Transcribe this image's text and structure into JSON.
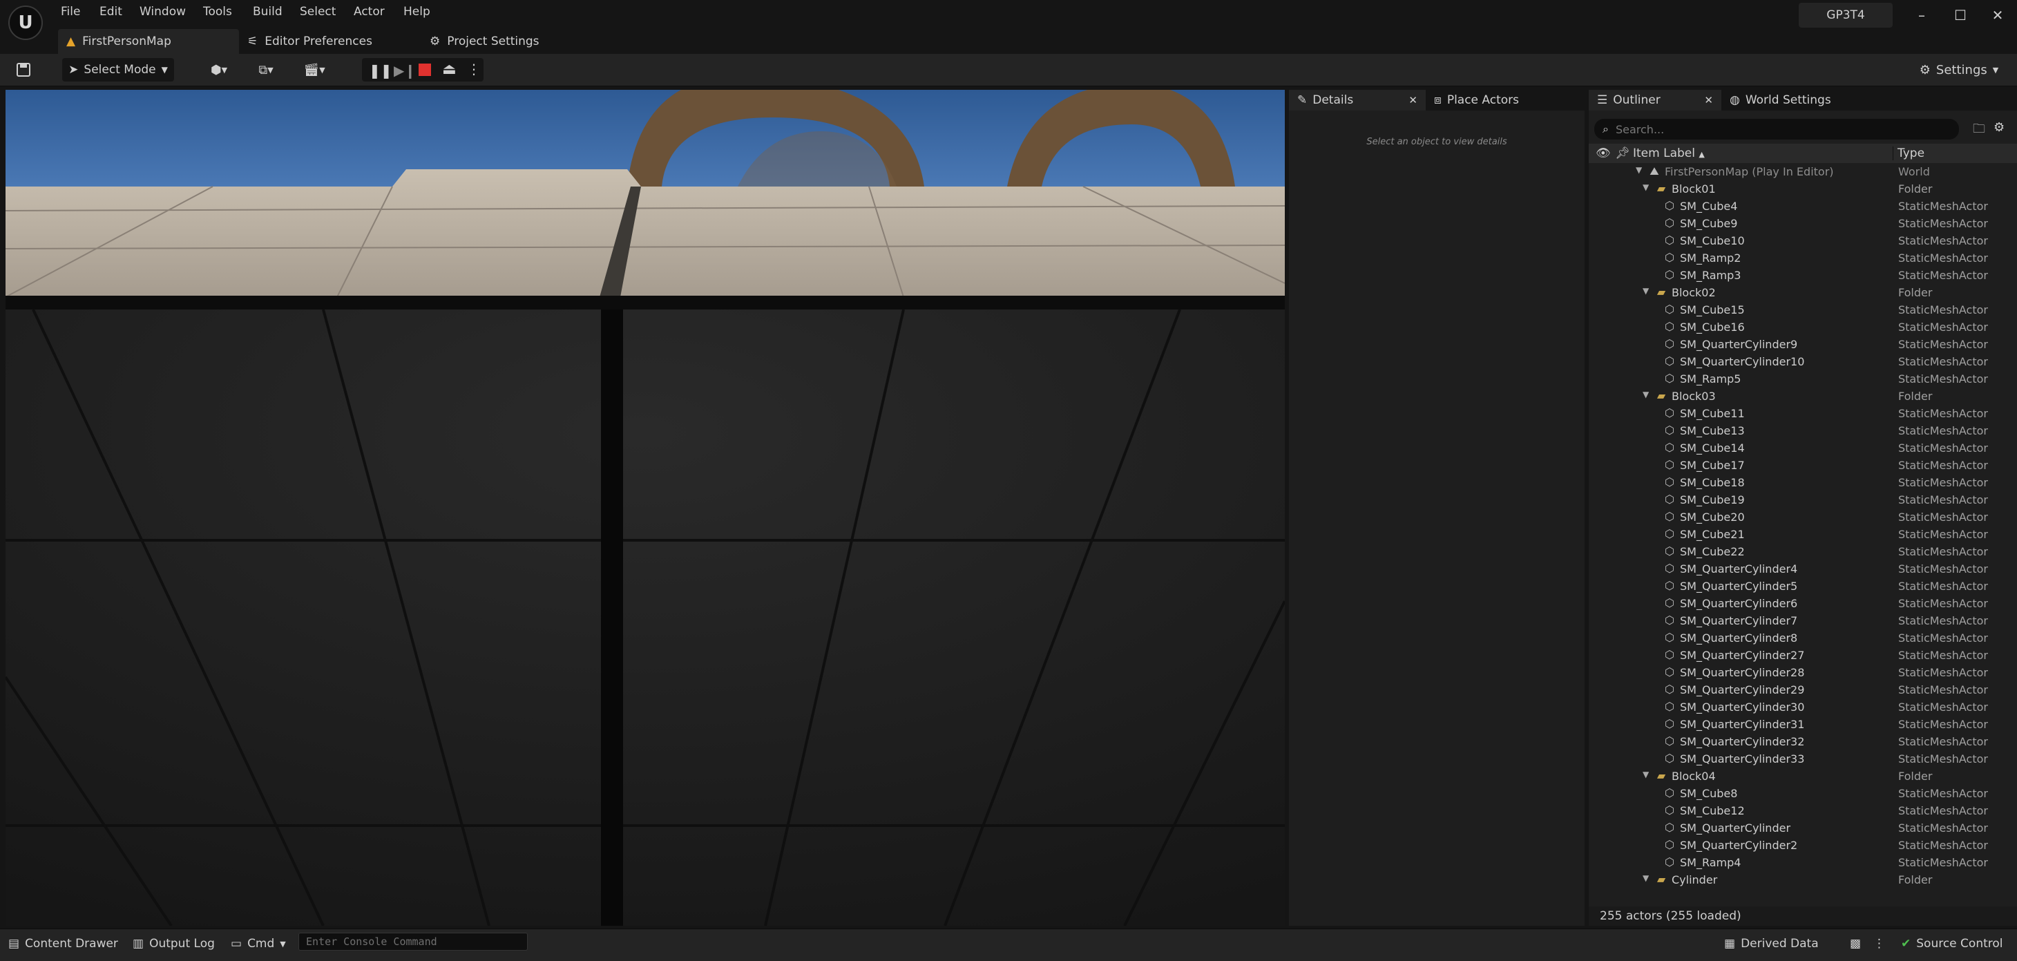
{
  "menu": [
    "File",
    "Edit",
    "Window",
    "Tools",
    "Build",
    "Select",
    "Actor",
    "Help"
  ],
  "project_name": "GP3T4",
  "tabs": {
    "map": "FirstPersonMap",
    "editor_prefs": "Editor Preferences",
    "project_settings": "Project Settings"
  },
  "toolbar": {
    "select_mode": "Select Mode",
    "settings": "Settings"
  },
  "details": {
    "tab_details": "Details",
    "tab_place": "Place Actors",
    "empty_message": "Select an object to view details"
  },
  "outliner": {
    "tab_outliner": "Outliner",
    "tab_world": "World Settings",
    "search_placeholder": "Search...",
    "col_label": "Item Label",
    "col_type": "Type",
    "footer": "255 actors (255 loaded)",
    "rows": [
      {
        "label": "FirstPersonMap (Play In Editor)",
        "type": "World",
        "kind": "world",
        "depth": 0
      },
      {
        "label": "Block01",
        "type": "Folder",
        "kind": "folder",
        "depth": 1
      },
      {
        "label": "SM_Cube4",
        "type": "StaticMeshActor",
        "kind": "actor",
        "depth": 2
      },
      {
        "label": "SM_Cube9",
        "type": "StaticMeshActor",
        "kind": "actor",
        "depth": 2
      },
      {
        "label": "SM_Cube10",
        "type": "StaticMeshActor",
        "kind": "actor",
        "depth": 2
      },
      {
        "label": "SM_Ramp2",
        "type": "StaticMeshActor",
        "kind": "actor",
        "depth": 2
      },
      {
        "label": "SM_Ramp3",
        "type": "StaticMeshActor",
        "kind": "actor",
        "depth": 2
      },
      {
        "label": "Block02",
        "type": "Folder",
        "kind": "folder",
        "depth": 1
      },
      {
        "label": "SM_Cube15",
        "type": "StaticMeshActor",
        "kind": "actor",
        "depth": 2
      },
      {
        "label": "SM_Cube16",
        "type": "StaticMeshActor",
        "kind": "actor",
        "depth": 2
      },
      {
        "label": "SM_QuarterCylinder9",
        "type": "StaticMeshActor",
        "kind": "actor",
        "depth": 2
      },
      {
        "label": "SM_QuarterCylinder10",
        "type": "StaticMeshActor",
        "kind": "actor",
        "depth": 2
      },
      {
        "label": "SM_Ramp5",
        "type": "StaticMeshActor",
        "kind": "actor",
        "depth": 2
      },
      {
        "label": "Block03",
        "type": "Folder",
        "kind": "folder",
        "depth": 1
      },
      {
        "label": "SM_Cube11",
        "type": "StaticMeshActor",
        "kind": "actor",
        "depth": 2
      },
      {
        "label": "SM_Cube13",
        "type": "StaticMeshActor",
        "kind": "actor",
        "depth": 2
      },
      {
        "label": "SM_Cube14",
        "type": "StaticMeshActor",
        "kind": "actor",
        "depth": 2
      },
      {
        "label": "SM_Cube17",
        "type": "StaticMeshActor",
        "kind": "actor",
        "depth": 2
      },
      {
        "label": "SM_Cube18",
        "type": "StaticMeshActor",
        "kind": "actor",
        "depth": 2
      },
      {
        "label": "SM_Cube19",
        "type": "StaticMeshActor",
        "kind": "actor",
        "depth": 2
      },
      {
        "label": "SM_Cube20",
        "type": "StaticMeshActor",
        "kind": "actor",
        "depth": 2
      },
      {
        "label": "SM_Cube21",
        "type": "StaticMeshActor",
        "kind": "actor",
        "depth": 2
      },
      {
        "label": "SM_Cube22",
        "type": "StaticMeshActor",
        "kind": "actor",
        "depth": 2
      },
      {
        "label": "SM_QuarterCylinder4",
        "type": "StaticMeshActor",
        "kind": "actor",
        "depth": 2
      },
      {
        "label": "SM_QuarterCylinder5",
        "type": "StaticMeshActor",
        "kind": "actor",
        "depth": 2
      },
      {
        "label": "SM_QuarterCylinder6",
        "type": "StaticMeshActor",
        "kind": "actor",
        "depth": 2
      },
      {
        "label": "SM_QuarterCylinder7",
        "type": "StaticMeshActor",
        "kind": "actor",
        "depth": 2
      },
      {
        "label": "SM_QuarterCylinder8",
        "type": "StaticMeshActor",
        "kind": "actor",
        "depth": 2
      },
      {
        "label": "SM_QuarterCylinder27",
        "type": "StaticMeshActor",
        "kind": "actor",
        "depth": 2
      },
      {
        "label": "SM_QuarterCylinder28",
        "type": "StaticMeshActor",
        "kind": "actor",
        "depth": 2
      },
      {
        "label": "SM_QuarterCylinder29",
        "type": "StaticMeshActor",
        "kind": "actor",
        "depth": 2
      },
      {
        "label": "SM_QuarterCylinder30",
        "type": "StaticMeshActor",
        "kind": "actor",
        "depth": 2
      },
      {
        "label": "SM_QuarterCylinder31",
        "type": "StaticMeshActor",
        "kind": "actor",
        "depth": 2
      },
      {
        "label": "SM_QuarterCylinder32",
        "type": "StaticMeshActor",
        "kind": "actor",
        "depth": 2
      },
      {
        "label": "SM_QuarterCylinder33",
        "type": "StaticMeshActor",
        "kind": "actor",
        "depth": 2
      },
      {
        "label": "Block04",
        "type": "Folder",
        "kind": "folder",
        "depth": 1
      },
      {
        "label": "SM_Cube8",
        "type": "StaticMeshActor",
        "kind": "actor",
        "depth": 2
      },
      {
        "label": "SM_Cube12",
        "type": "StaticMeshActor",
        "kind": "actor",
        "depth": 2
      },
      {
        "label": "SM_QuarterCylinder",
        "type": "StaticMeshActor",
        "kind": "actor",
        "depth": 2
      },
      {
        "label": "SM_QuarterCylinder2",
        "type": "StaticMeshActor",
        "kind": "actor",
        "depth": 2
      },
      {
        "label": "SM_Ramp4",
        "type": "StaticMeshActor",
        "kind": "actor",
        "depth": 2
      },
      {
        "label": "Cylinder",
        "type": "Folder",
        "kind": "folder",
        "depth": 1
      }
    ]
  },
  "statusbar": {
    "content_drawer": "Content Drawer",
    "output_log": "Output Log",
    "cmd": "Cmd",
    "console_placeholder": "Enter Console Command",
    "derived_data": "Derived Data",
    "source_control": "Source Control"
  },
  "colors": {
    "stop_red": "#e0322f",
    "folder": "#c9a64d",
    "source_control_ok": "#4fbf4f"
  }
}
